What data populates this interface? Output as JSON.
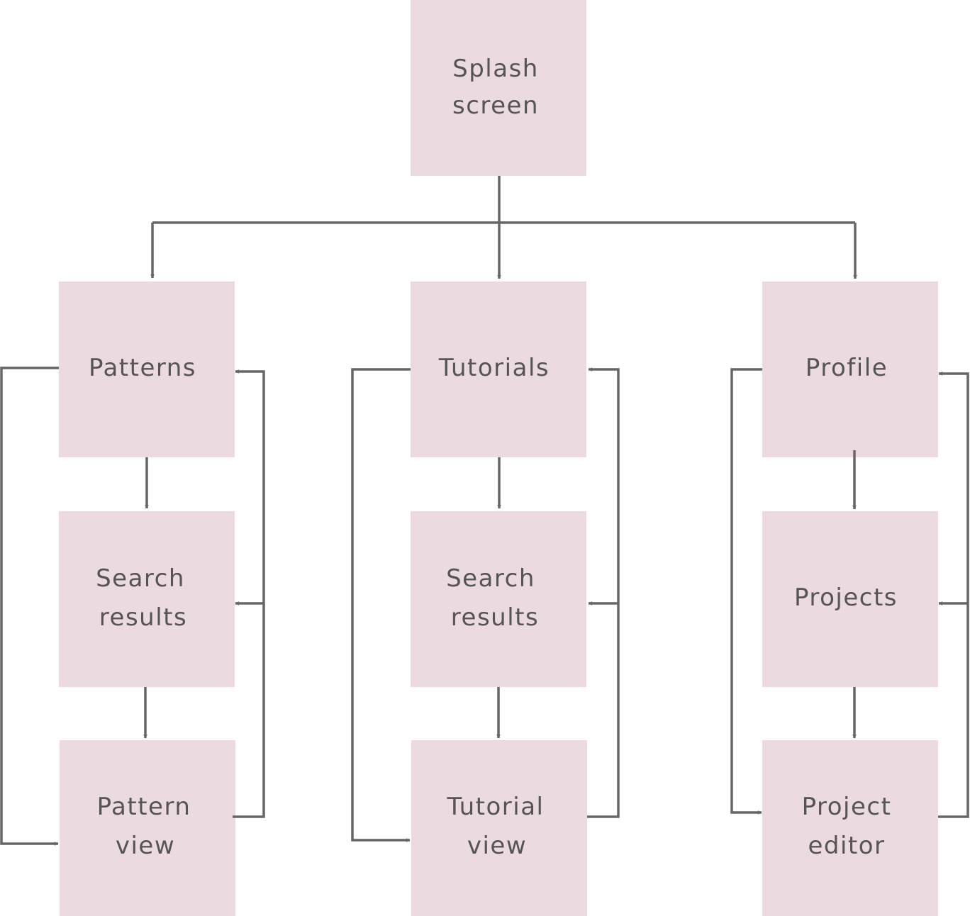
{
  "colors": {
    "box": "#ebdbe1",
    "connector": "#666666",
    "text": "#555555"
  },
  "nodes": {
    "splash": [
      "Splash",
      "screen"
    ],
    "patterns": [
      "Patterns"
    ],
    "tutorials": [
      "Tutorials"
    ],
    "profile": [
      "Profile"
    ],
    "pattern_search": [
      "Search",
      "results"
    ],
    "tutorial_search": [
      "Search",
      "results"
    ],
    "projects": [
      "Projects"
    ],
    "pattern_view": [
      "Pattern",
      "view"
    ],
    "tutorial_view": [
      "Tutorial",
      "view"
    ],
    "project_editor": [
      "Project",
      "editor"
    ]
  }
}
